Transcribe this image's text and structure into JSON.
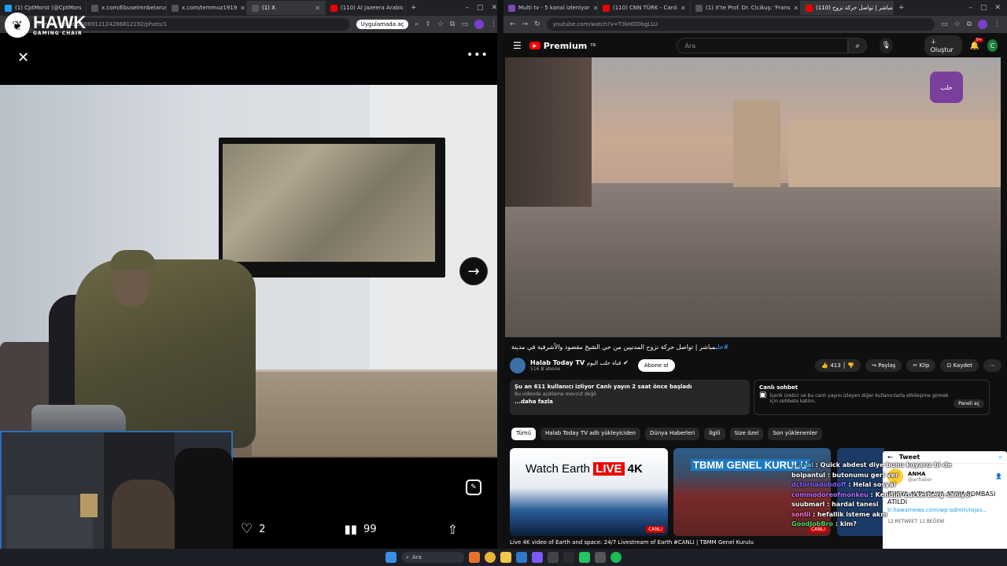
{
  "left_browser": {
    "tabs": [
      {
        "label": "(1) CptMorst (@CptMors",
        "color": "#1da1f2"
      },
      {
        "label": "x.com/Ebuselmnbelarus",
        "color": "#555"
      },
      {
        "label": "x.com/temmuz1919",
        "color": "#555"
      },
      {
        "label": "(1) X",
        "color": "#555"
      },
      {
        "label": "(110) Al Jazeera Arabic",
        "color": "#e00"
      }
    ],
    "url": "/mnktn/status/2008912124286812192/photo/1",
    "open_in_app": "Uygulamada aç"
  },
  "overlay_logo": {
    "brand": "HAWK",
    "tagline": "GAMING CHAIR"
  },
  "photo_viewer": {
    "like_count": "2",
    "view_count": "99"
  },
  "right_browser": {
    "tabs": [
      {
        "label": "Multi tv - 5 kanal izleniyor",
        "color": "#7b4bb8"
      },
      {
        "label": "(110) CNN TÜRK - Canlı",
        "color": "#e00"
      },
      {
        "label": "(1) X'te Prof. Dr. Cicikuş: 'Frans",
        "color": "#555"
      },
      {
        "label": "(110) مباشر | تواصل حركة نزوح",
        "color": "#e00"
      }
    ],
    "url": "youtube.com/watch?v=T3kHDDbgLLU"
  },
  "youtube": {
    "logo": "Premium",
    "logo_sup": "TR",
    "search_placeholder": "Ara",
    "create": "Oluştur",
    "notif_badge": "9+",
    "avatar_letter": "C",
    "video_title_tag": "#حلب",
    "video_title": "مباشر | تواصل حركة نزوح المدنيين من حي الشيخ مقصود والأشرفية في مدينة",
    "channel_name": "Halab Today TV",
    "channel_arabic": "قناة حلب اليوم",
    "subscribers": "516 B abone",
    "subscribe_label": "Abone ol",
    "likes": "413",
    "share": "Paylaş",
    "clip": "Klip",
    "save": "Kaydet",
    "desc_line1": "Şu an 611 kullanıcı izliyor  Canlı yayın 2 saat önce başladı",
    "desc_line2": "Bu videoda açıklama mevcut değil.",
    "desc_more": "...daha fazla",
    "chat_title": "Canlı sohbet",
    "chat_desc": "İçerik üretici ve bu canlı yayını izleyen diğer kullanıcılarla etkileşime girmek için sohbete katılın.",
    "chat_panel": "Paneli aç",
    "chips": [
      "Tümü",
      "Halab Today TV adlı yükleyiciden",
      "Dünya Haberleri",
      "İlgili",
      "Size özel",
      "Son yüklenenler"
    ],
    "thumb1_text": "Watch Earth",
    "thumb1_live": "LIVE",
    "thumb1_4k": "4K",
    "thumb1_badge": "CANLI",
    "thumb2_text": "TBMM GENEL KURULU",
    "thumb2_badge": "CANLI",
    "video1_title": "Live 4K video of Earth and space: 24/7 Livestream of Earth",
    "video2_title": "#CANLI | TBMM Genel Kurulu"
  },
  "tweet": {
    "header": "Tweet",
    "author": "ANHA",
    "handle": "@anhaber",
    "text": "RUSYA AVRUPA'YA ATOM BOMBASI ATILDI",
    "link": "tr.hawarnews.com/wp-admin/rojav...",
    "retweets": "12",
    "likes": "11"
  },
  "chat_overlay": [
    {
      "user": "...aval",
      "color": "#5ecbff",
      "msg": "Quick abdest diye bunu koyarız bi de"
    },
    {
      "user": "bolpantul",
      "color": "#ffffff",
      "msg": "butonumu geri ver"
    },
    {
      "user": "dctornadobdoff",
      "color": "#7b61ff",
      "msg": "Helal sosyal"
    },
    {
      "user": "commodoreofmonkeu",
      "color": "#b36bff",
      "msg": "Kendini zuckerberg sanıyor"
    },
    {
      "user": "suubmarl",
      "color": "#ffffff",
      "msg": "hardal tanesi"
    },
    {
      "user": "sonlii",
      "color": "#ff7ad9",
      "msg": "hefallik isteme akm"
    },
    {
      "user": "GoodJobBro",
      "color": "#4cd964",
      "msg": "kim?"
    }
  ],
  "taskbar": {
    "search": "Ara"
  }
}
